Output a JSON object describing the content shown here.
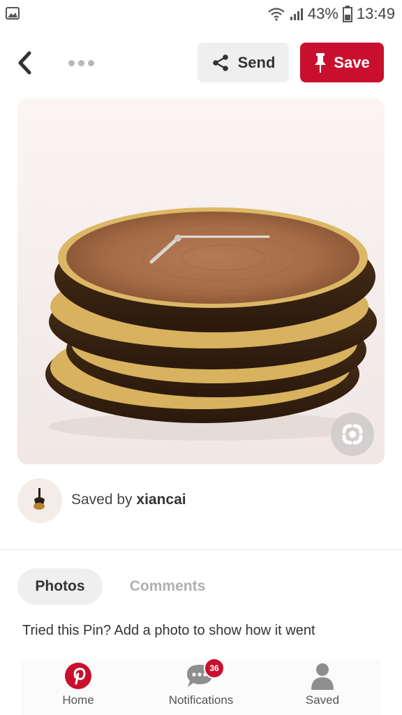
{
  "status_bar": {
    "battery": "43%",
    "time": "13:49"
  },
  "actions": {
    "send_label": "Send",
    "save_label": "Save"
  },
  "pin": {
    "saved_by_prefix": "Saved by",
    "saved_by_user": "xiancai"
  },
  "tabs": [
    {
      "label": "Photos",
      "active": true
    },
    {
      "label": "Comments",
      "active": false
    }
  ],
  "prompt": "Tried this Pin? Add a photo to show how it went",
  "bottom_nav": [
    {
      "label": "Home",
      "icon": "pinterest-logo-icon"
    },
    {
      "label": "Notifications",
      "icon": "chat-bubble-icon",
      "badge": "36"
    },
    {
      "label": "Saved",
      "icon": "person-icon"
    }
  ],
  "colors": {
    "brand_red": "#c8102e",
    "button_gray": "#efefef"
  }
}
